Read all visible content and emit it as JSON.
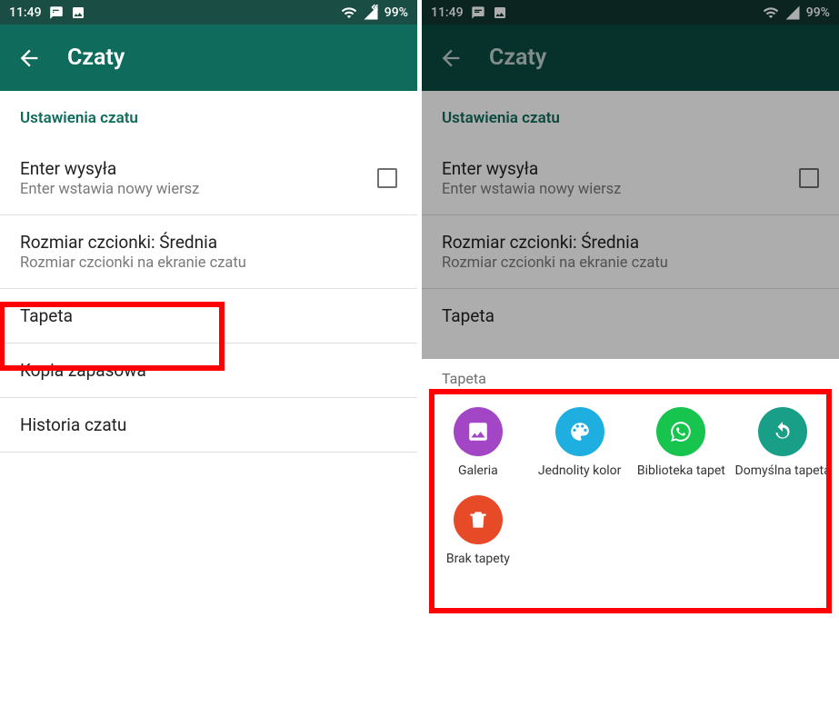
{
  "status": {
    "time": "11:49",
    "battery": "99%"
  },
  "left": {
    "title": "Czaty",
    "section_header": "Ustawienia czatu",
    "enter": {
      "primary": "Enter wysyła",
      "secondary": "Enter wstawia nowy wiersz"
    },
    "font": {
      "primary": "Rozmiar czcionki: Średnia",
      "secondary": "Rozmiar czcionki na ekranie czatu"
    },
    "wallpaper": {
      "primary": "Tapeta"
    },
    "backup": {
      "primary": "Kopia zapasowa"
    },
    "history": {
      "primary": "Historia czatu"
    }
  },
  "right": {
    "title": "Czaty",
    "section_header": "Ustawienia czatu",
    "enter": {
      "primary": "Enter wysyła",
      "secondary": "Enter wstawia nowy wiersz"
    },
    "font": {
      "primary": "Rozmiar czcionki: Średnia",
      "secondary": "Rozmiar czcionki na ekranie czatu"
    },
    "wallpaper_row": {
      "primary": "Tapeta"
    },
    "sheet_title": "Tapeta",
    "options": {
      "gallery": "Galeria",
      "solid": "Jednolity kolor",
      "library": "Biblioteka tapet",
      "default": "Domyślna tapeta",
      "none": "Brak tapety"
    }
  }
}
